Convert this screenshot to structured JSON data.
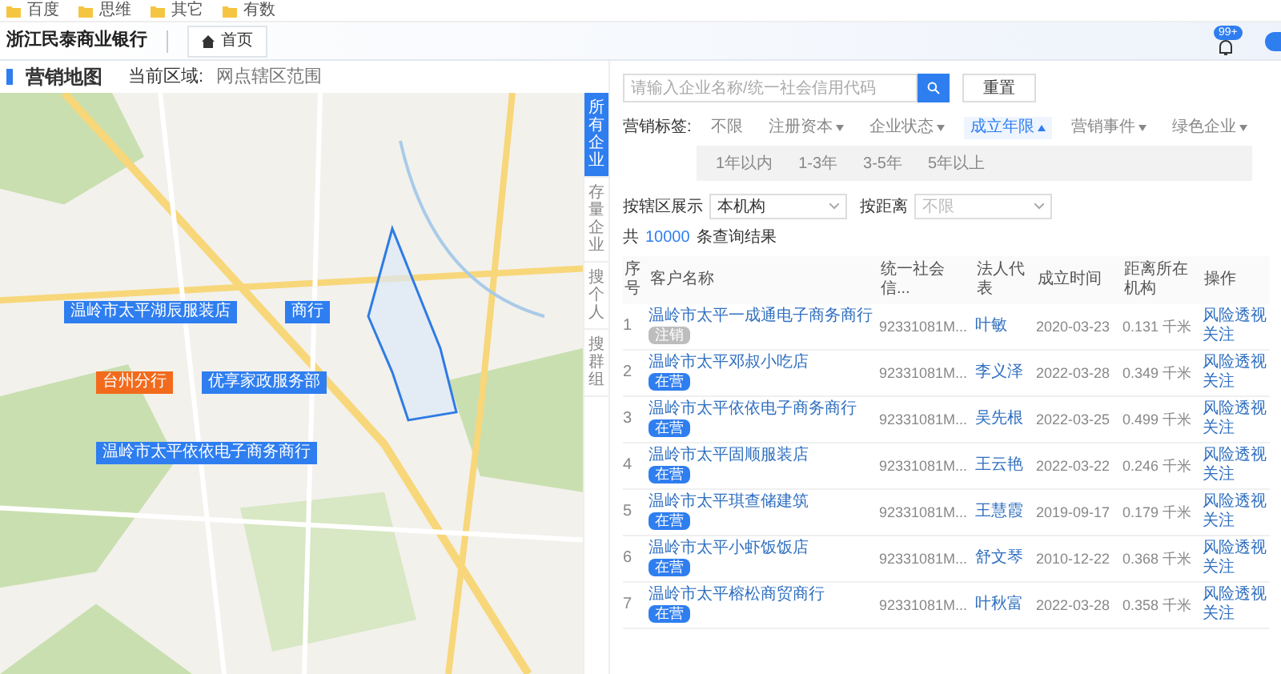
{
  "bookmarks": [
    {
      "label": "百度"
    },
    {
      "label": "思维"
    },
    {
      "label": "其它"
    },
    {
      "label": "有数"
    }
  ],
  "header": {
    "logo": "浙江民泰商业银行",
    "tab": "首页",
    "badge": "99+"
  },
  "page_title": "营销地图",
  "region_label": "当前区域:",
  "region_value": "网点辖区范围",
  "map": {
    "markers": [
      {
        "label": "温岭市太平湖辰服装店",
        "kind": "company"
      },
      {
        "label": "商行",
        "kind": "company"
      },
      {
        "label": "台州分行",
        "kind": "branch"
      },
      {
        "label": "优享家政服务部",
        "kind": "company"
      },
      {
        "label": "温岭市太平依依电子商务商行",
        "kind": "company"
      }
    ]
  },
  "side_tabs": [
    {
      "label": "所有企业",
      "selected": true
    },
    {
      "label": "存量企业",
      "selected": false
    },
    {
      "label": "搜个人",
      "selected": false
    },
    {
      "label": "搜群组",
      "selected": false
    }
  ],
  "search": {
    "placeholder": "请输入企业名称/统一社会信用代码",
    "reset": "重置"
  },
  "tags": {
    "label": "营销标签:",
    "items": [
      {
        "label": "不限",
        "kind": "plain",
        "selected": false
      },
      {
        "label": "注册资本",
        "kind": "dropdown",
        "selected": false
      },
      {
        "label": "企业状态",
        "kind": "dropdown",
        "selected": false
      },
      {
        "label": "成立年限",
        "kind": "dropdown",
        "selected": true
      },
      {
        "label": "营销事件",
        "kind": "dropdown",
        "selected": false
      },
      {
        "label": "绿色企业",
        "kind": "dropdown",
        "selected": false
      }
    ],
    "options": [
      "1年以内",
      "1-3年",
      "3-5年",
      "5年以上"
    ]
  },
  "filters": [
    {
      "label": "按辖区展示",
      "value": "本机构"
    },
    {
      "label": "按距离",
      "placeholder": "不限"
    }
  ],
  "result": {
    "prefix": "共",
    "count": "10000",
    "suffix": "条查询结果"
  },
  "table": {
    "columns": [
      "序号",
      "客户名称",
      "统一社会信...",
      "法人代表",
      "成立时间",
      "距离所在机构",
      "操作"
    ],
    "rows": [
      {
        "index": "1",
        "name": "温岭市太平一成通电子商务商行",
        "status": {
          "label": "注销",
          "kind": "closed"
        },
        "code": "92331081M...",
        "legal": "叶敏",
        "date": "2020-03-23",
        "distance": "0.131 千米",
        "actions": [
          "风险透视",
          "关注"
        ]
      },
      {
        "index": "2",
        "name": "温岭市太平邓叔小吃店",
        "status": {
          "label": "在营",
          "kind": "active"
        },
        "code": "92331081M...",
        "legal": "李义泽",
        "date": "2022-03-28",
        "distance": "0.349 千米",
        "actions": [
          "风险透视",
          "关注"
        ]
      },
      {
        "index": "3",
        "name": "温岭市太平依依电子商务商行",
        "status": {
          "label": "在营",
          "kind": "active"
        },
        "code": "92331081M...",
        "legal": "吴先根",
        "date": "2022-03-25",
        "distance": "0.499 千米",
        "actions": [
          "风险透视",
          "关注"
        ]
      },
      {
        "index": "4",
        "name": "温岭市太平固顺服装店",
        "status": {
          "label": "在营",
          "kind": "active"
        },
        "code": "92331081M...",
        "legal": "王云艳",
        "date": "2022-03-22",
        "distance": "0.246 千米",
        "actions": [
          "风险透视",
          "关注"
        ]
      },
      {
        "index": "5",
        "name": "温岭市太平琪查储建筑",
        "status": {
          "label": "在营",
          "kind": "active"
        },
        "code": "92331081M...",
        "legal": "王慧霞",
        "date": "2019-09-17",
        "distance": "0.179 千米",
        "actions": [
          "风险透视",
          "关注"
        ]
      },
      {
        "index": "6",
        "name": "温岭市太平小虾饭饭店",
        "status": {
          "label": "在营",
          "kind": "active"
        },
        "code": "92331081M...",
        "legal": "舒文琴",
        "date": "2010-12-22",
        "distance": "0.368 千米",
        "actions": [
          "风险透视",
          "关注"
        ]
      },
      {
        "index": "7",
        "name": "温岭市太平榕松商贸商行",
        "status": {
          "label": "在营",
          "kind": "active"
        },
        "code": "92331081M...",
        "legal": "叶秋富",
        "date": "2022-03-28",
        "distance": "0.358 千米",
        "actions": [
          "风险透视",
          "关注"
        ]
      }
    ]
  }
}
